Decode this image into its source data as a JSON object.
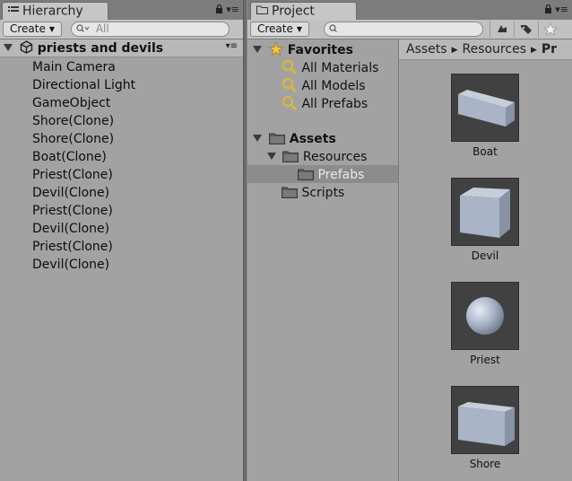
{
  "hierarchy": {
    "tab_label": "Hierarchy",
    "create_label": "Create",
    "search_placeholder": "All",
    "scene_name": "priests and devils",
    "items": [
      "Main Camera",
      "Directional Light",
      "GameObject",
      "Shore(Clone)",
      "Shore(Clone)",
      "Boat(Clone)",
      "Priest(Clone)",
      "Devil(Clone)",
      "Priest(Clone)",
      "Devil(Clone)",
      "Priest(Clone)",
      "Devil(Clone)"
    ]
  },
  "project": {
    "tab_label": "Project",
    "create_label": "Create",
    "tree": {
      "favorites": "Favorites",
      "favorite_items": [
        "All Materials",
        "All Models",
        "All Prefabs"
      ],
      "assets": "Assets",
      "resources": "Resources",
      "prefabs": "Prefabs",
      "scripts": "Scripts"
    },
    "breadcrumb": [
      "Assets",
      "Resources",
      "Pr"
    ],
    "assets": [
      {
        "label": "Boat",
        "icon": "box-flat-icon"
      },
      {
        "label": "Devil",
        "icon": "cube-icon"
      },
      {
        "label": "Priest",
        "icon": "sphere-icon"
      },
      {
        "label": "Shore",
        "icon": "box-flat-icon"
      }
    ]
  },
  "colors": {
    "panel_bg": "#a2a2a2",
    "toolbar_bg": "#c1c1c1",
    "tab_bg": "#c6c6c6",
    "selection_bg": "#8c8c8c",
    "thumb_bg": "#414141",
    "primitive_color": "#a9b4c6"
  }
}
